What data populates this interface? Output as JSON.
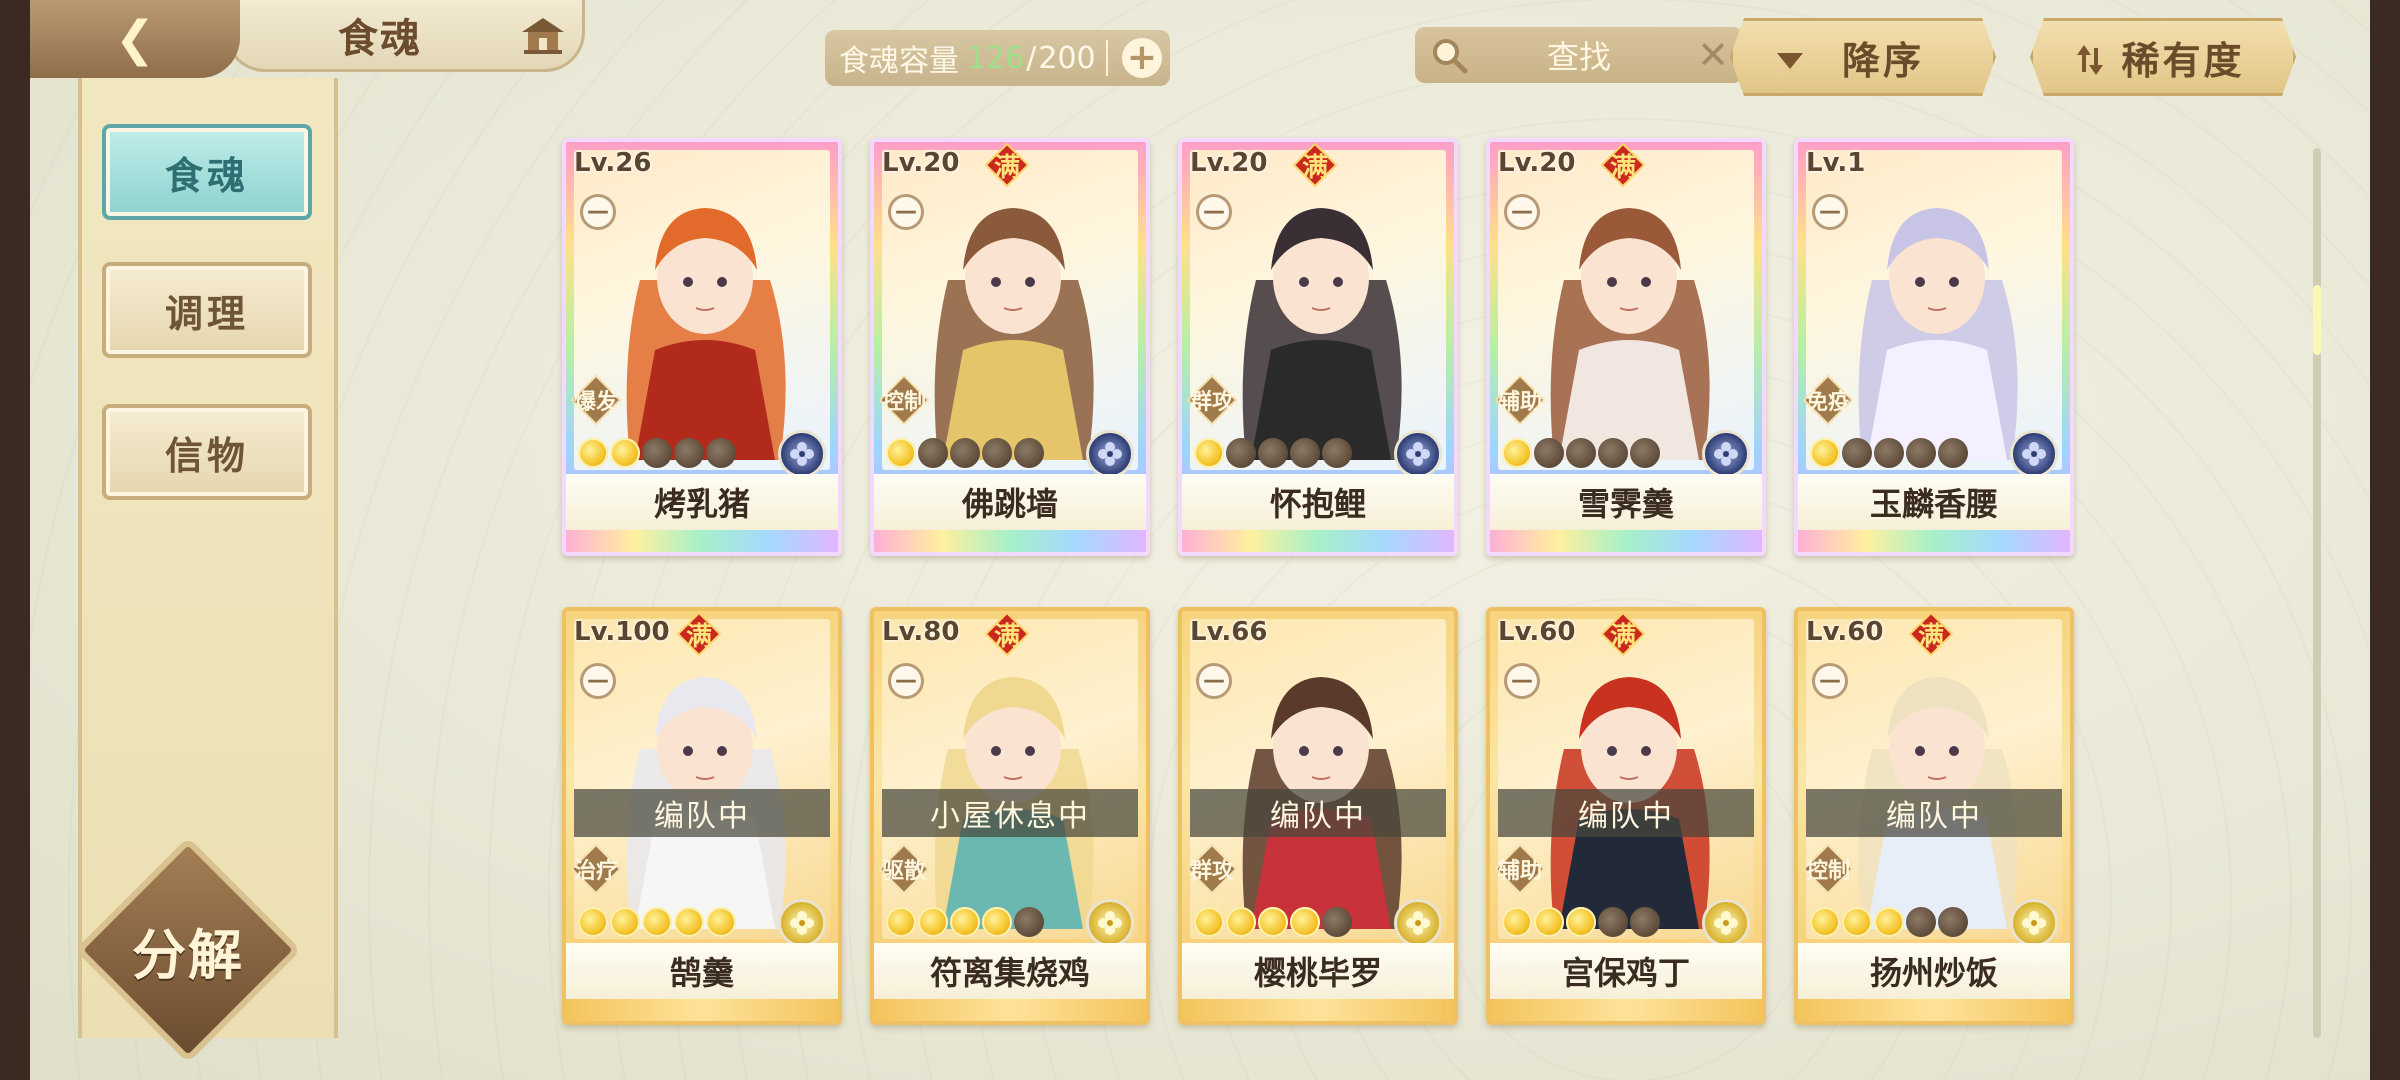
{
  "header": {
    "title": "食魂",
    "capacity_label": "食魂容量",
    "capacity_current": "126",
    "capacity_max": "200",
    "search_placeholder": "查找",
    "sort_order_label": "降序",
    "sort_field_label": "稀有度"
  },
  "sidebar": {
    "items": [
      {
        "label": "食魂",
        "active": true
      },
      {
        "label": "调理",
        "active": false
      },
      {
        "label": "信物",
        "active": false
      }
    ],
    "decompose_label": "分解"
  },
  "colors": {
    "active_tab": "#8ed1cf",
    "capacity_current": "#9ee08a",
    "star_on": "#f4c42a",
    "star_off": "#5d4a38"
  },
  "cards": [
    {
      "level": "Lv.26",
      "full": false,
      "role": "爆发",
      "stars": 2,
      "max_stars": 5,
      "element": "blue",
      "name": "烤乳猪",
      "status": "",
      "frame": "rainbow"
    },
    {
      "level": "Lv.20",
      "full": true,
      "full_label": "满",
      "role": "控制",
      "stars": 1,
      "max_stars": 5,
      "element": "blue",
      "name": "佛跳墙",
      "status": "",
      "frame": "rainbow"
    },
    {
      "level": "Lv.20",
      "full": true,
      "full_label": "满",
      "role": "群攻",
      "stars": 1,
      "max_stars": 5,
      "element": "blue",
      "name": "怀抱鲤",
      "status": "",
      "frame": "rainbow"
    },
    {
      "level": "Lv.20",
      "full": true,
      "full_label": "满",
      "role": "辅助",
      "stars": 1,
      "max_stars": 5,
      "element": "blue",
      "name": "雪霁羹",
      "status": "",
      "frame": "rainbow"
    },
    {
      "level": "Lv.1",
      "full": false,
      "role": "免疫",
      "stars": 1,
      "max_stars": 5,
      "element": "blue",
      "name": "玉麟香腰",
      "status": "",
      "frame": "rainbow"
    },
    {
      "level": "Lv.100",
      "full": true,
      "full_label": "满",
      "role": "治疗",
      "stars": 5,
      "max_stars": 5,
      "element": "yellow",
      "name": "鹄羹",
      "status": "编队中",
      "frame": "gold"
    },
    {
      "level": "Lv.80",
      "full": true,
      "full_label": "满",
      "role": "驱散",
      "stars": 4,
      "max_stars": 5,
      "element": "yellow",
      "name": "符离集烧鸡",
      "status": "小屋休息中",
      "frame": "gold"
    },
    {
      "level": "Lv.66",
      "full": false,
      "role": "群攻",
      "stars": 4,
      "max_stars": 5,
      "element": "yellow",
      "name": "樱桃毕罗",
      "status": "编队中",
      "frame": "gold"
    },
    {
      "level": "Lv.60",
      "full": true,
      "full_label": "满",
      "role": "辅助",
      "stars": 3,
      "max_stars": 5,
      "element": "yellow",
      "name": "宫保鸡丁",
      "status": "编队中",
      "frame": "gold"
    },
    {
      "level": "Lv.60",
      "full": true,
      "full_label": "满",
      "role": "控制",
      "stars": 3,
      "max_stars": 5,
      "element": "yellow",
      "name": "扬州炒饭",
      "status": "编队中",
      "frame": "gold"
    }
  ]
}
